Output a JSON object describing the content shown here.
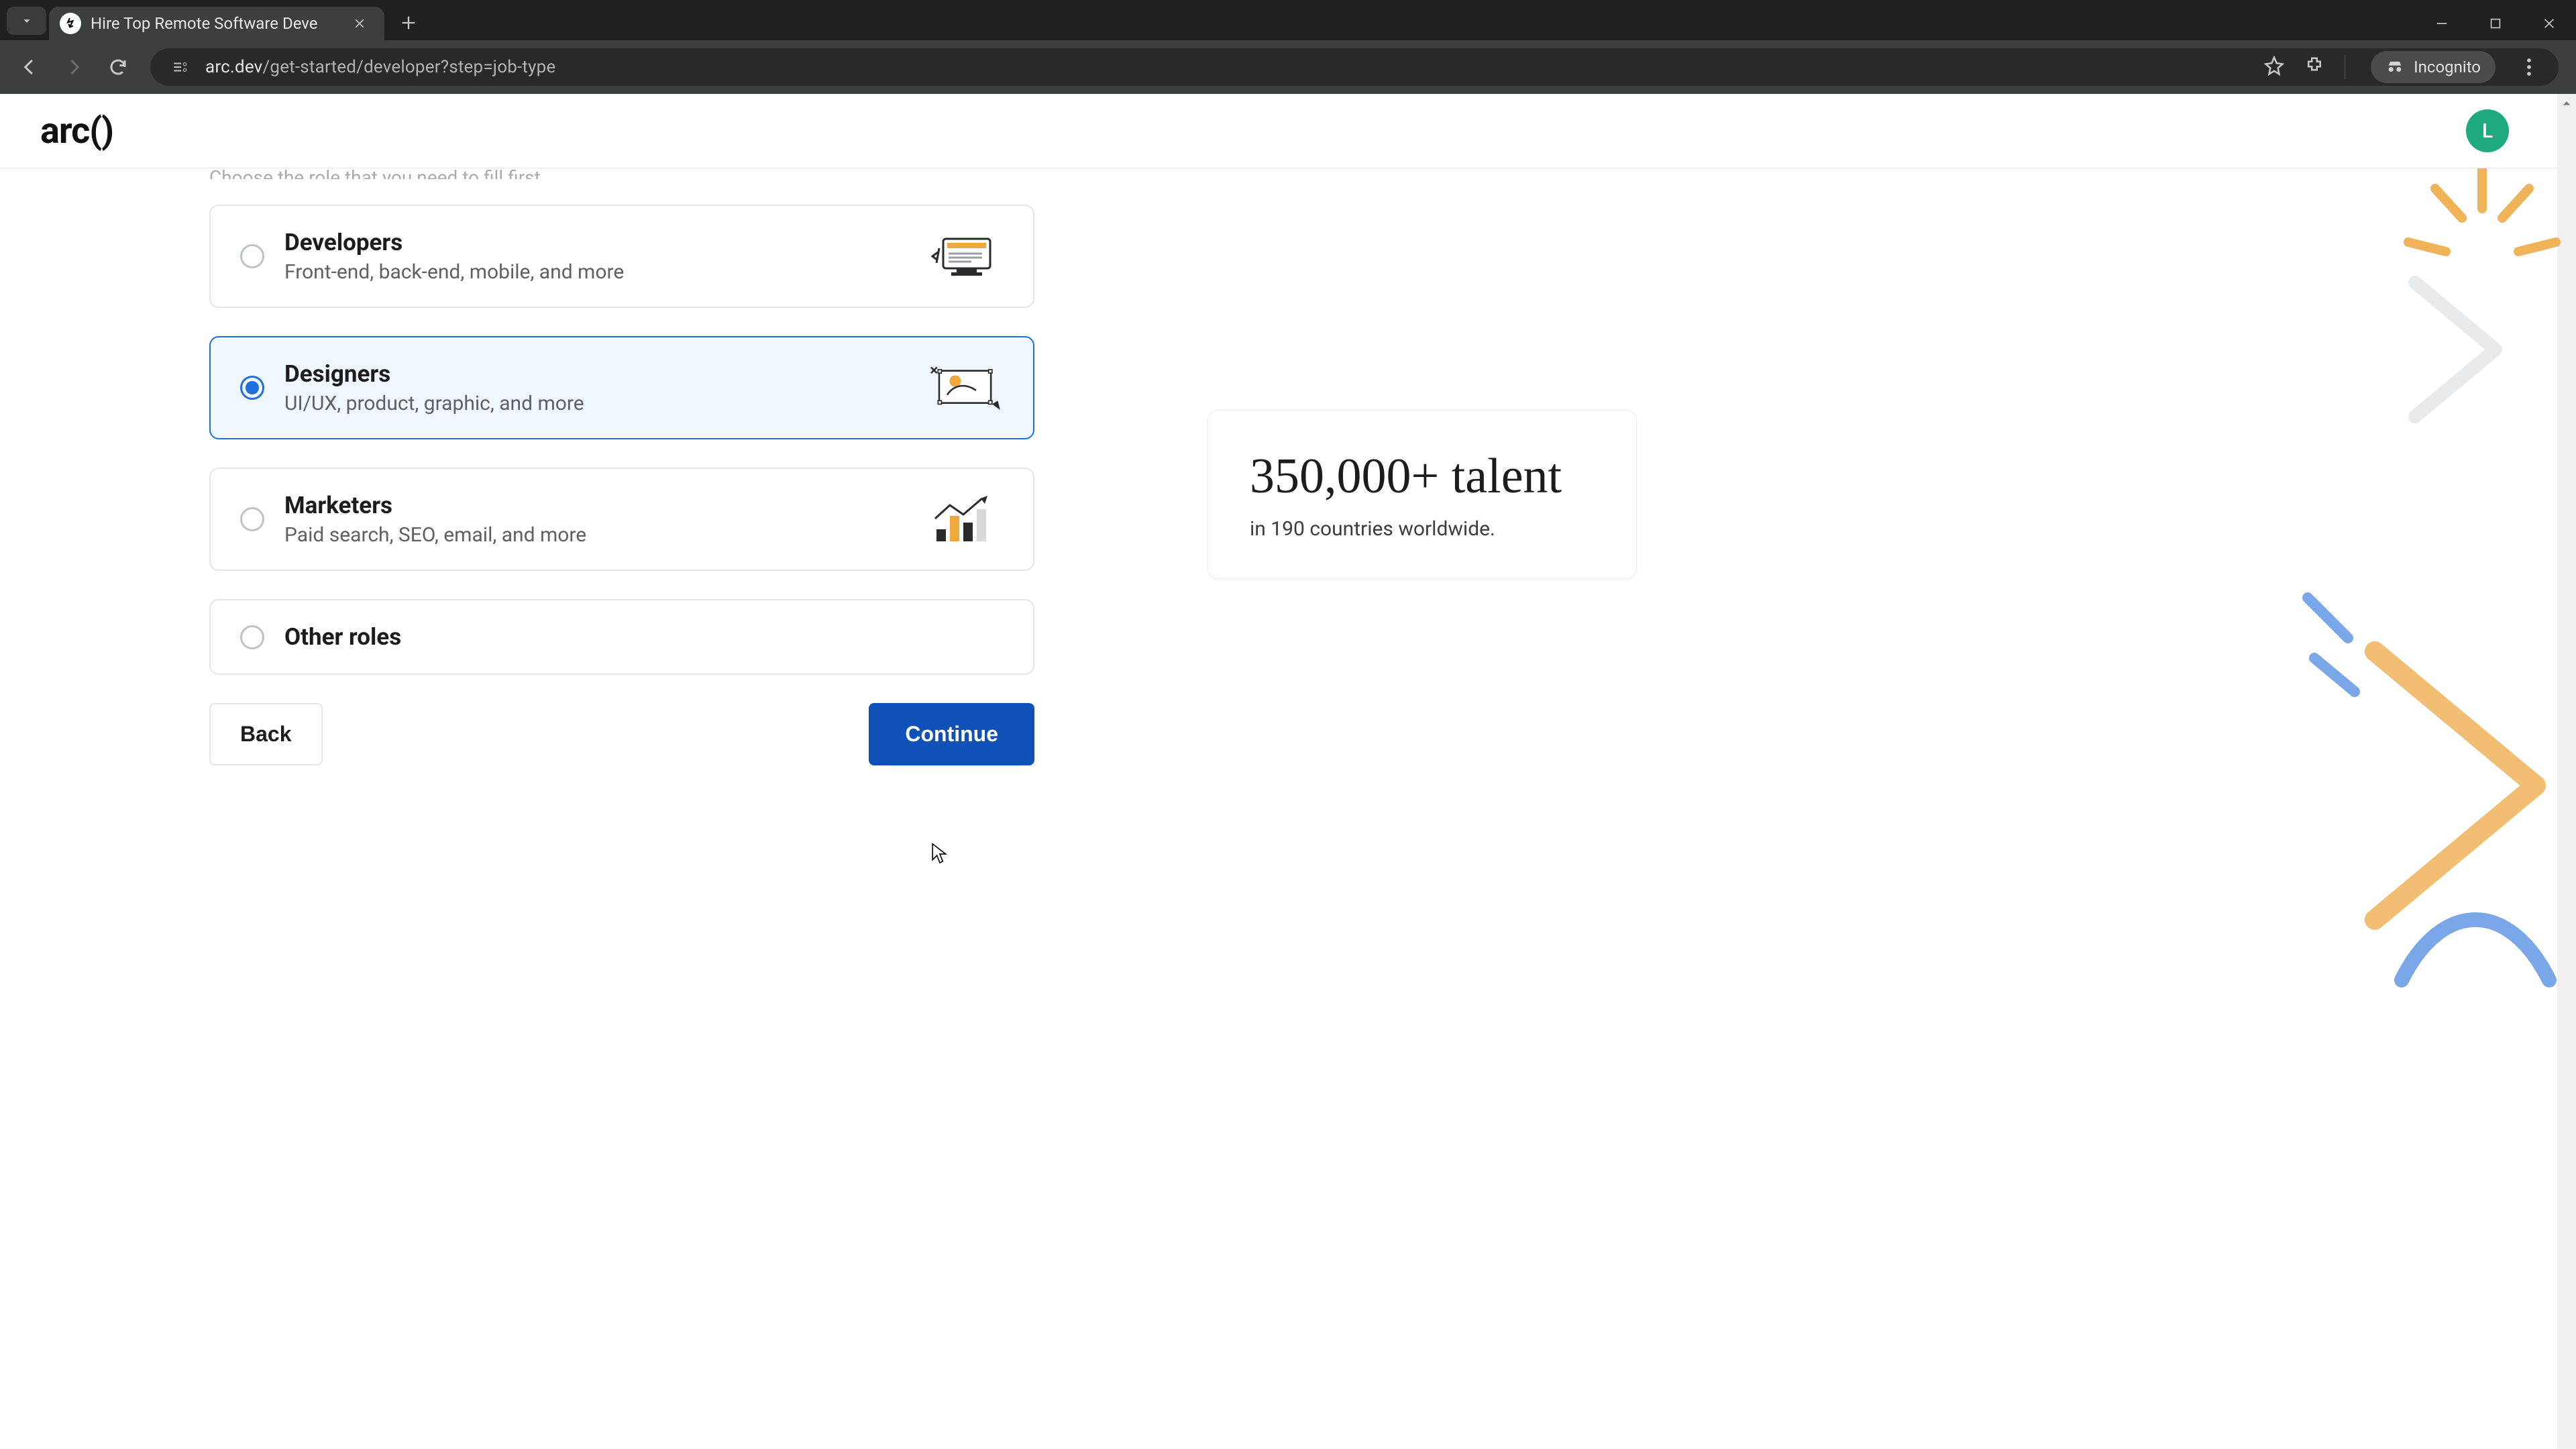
{
  "browser": {
    "tab_title": "Hire Top Remote Software Deve",
    "url_host": "arc.dev",
    "url_path": "/get-started/developer?step=job-type",
    "incognito_label": "Incognito"
  },
  "header": {
    "logo": "arc()",
    "avatar_initial": "L"
  },
  "subtitle_clipped": "Choose the role that you need to fill first.",
  "options": [
    {
      "title": "Developers",
      "desc": "Front-end, back-end, mobile, and more",
      "selected": false
    },
    {
      "title": "Designers",
      "desc": "UI/UX, product, graphic, and more",
      "selected": true
    },
    {
      "title": "Marketers",
      "desc": "Paid search, SEO, email, and more",
      "selected": false
    },
    {
      "title": "Other roles",
      "desc": "",
      "selected": false
    }
  ],
  "actions": {
    "back": "Back",
    "continue": "Continue"
  },
  "promo": {
    "headline": "350,000+ talent",
    "subline": "in 190 countries worldwide."
  }
}
